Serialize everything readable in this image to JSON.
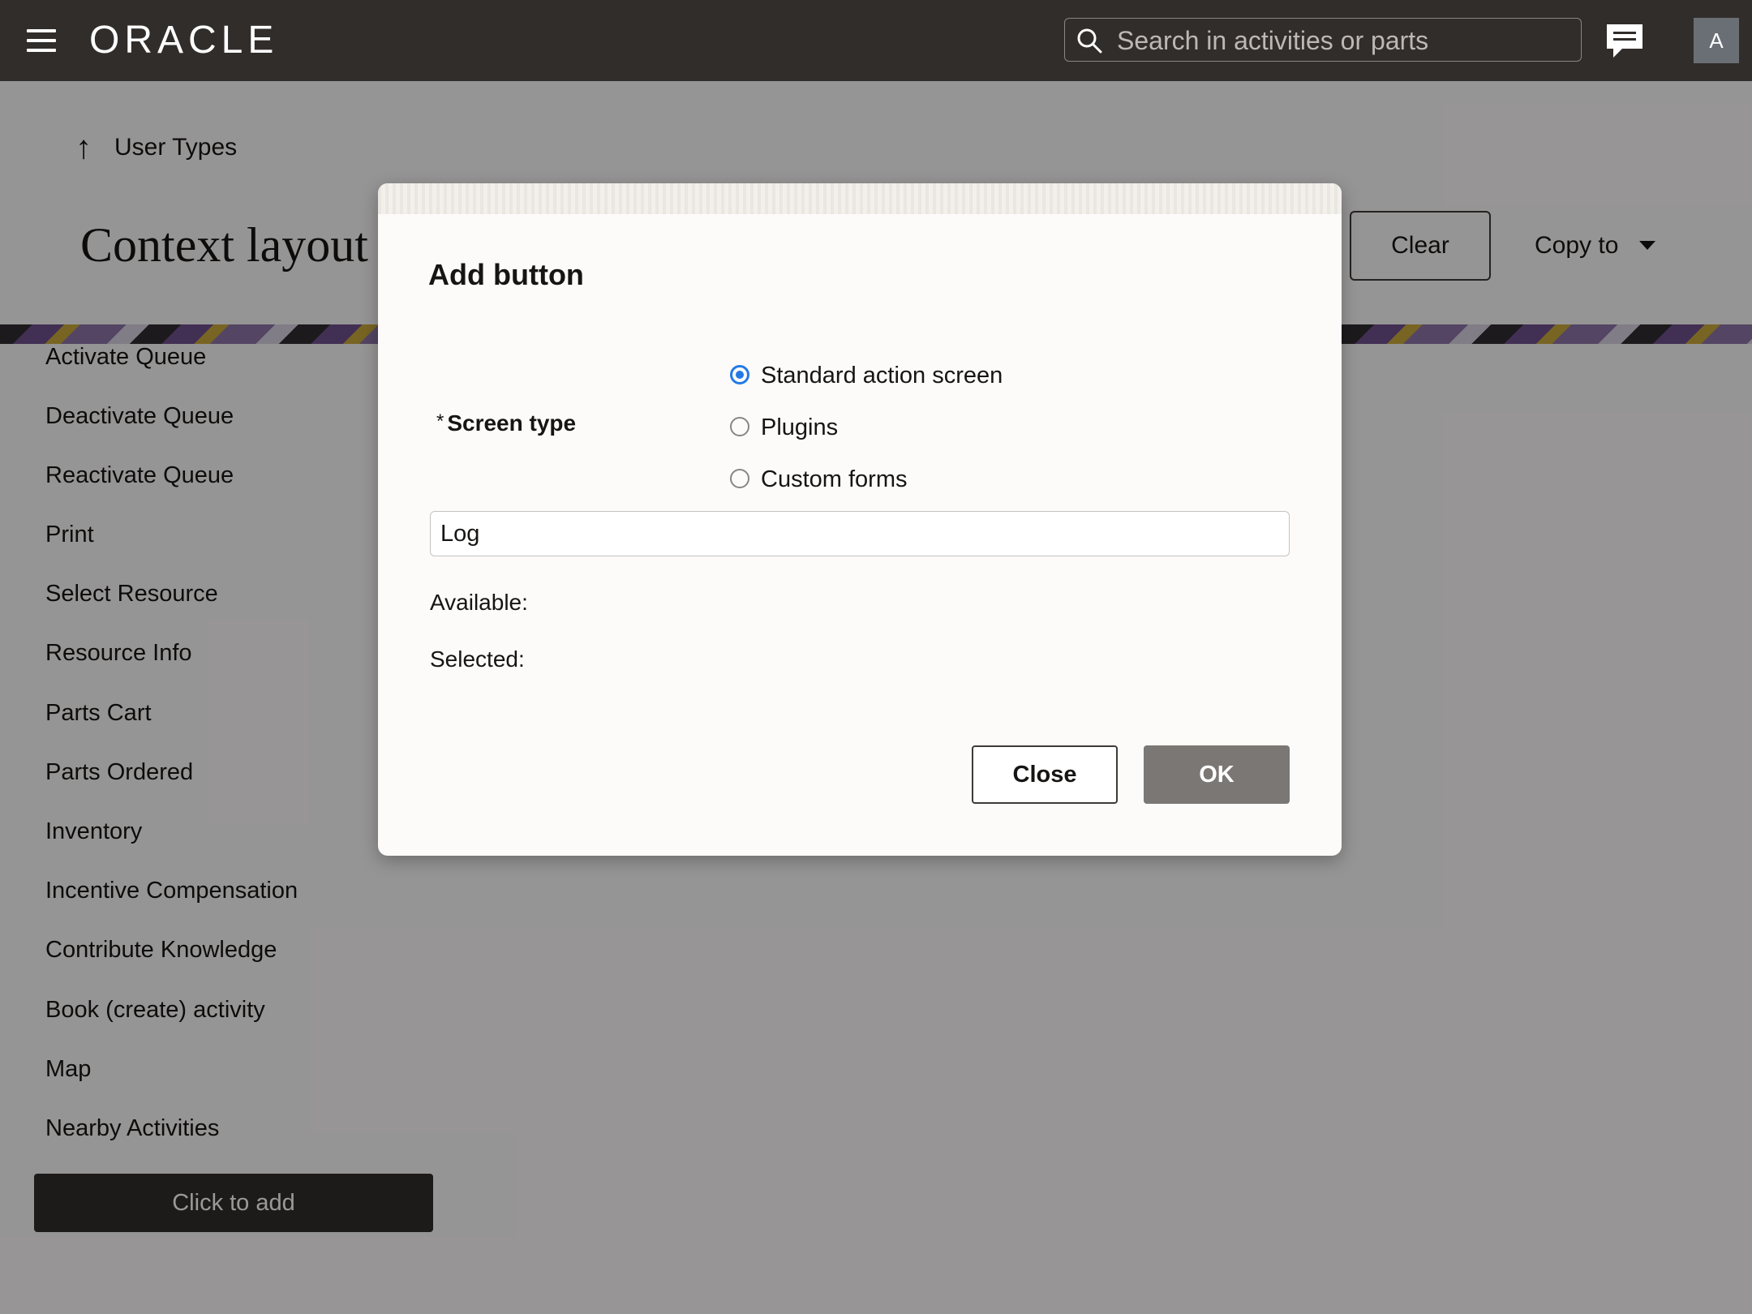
{
  "header": {
    "brand": "ORACLE",
    "search_placeholder": "Search in activities or parts",
    "avatar_initial": "A"
  },
  "page": {
    "back_label": "User Types",
    "title": "Context layout",
    "clear_label": "Clear",
    "copy_to_label": "Copy to"
  },
  "list": {
    "items": [
      "Activate Queue",
      "Deactivate Queue",
      "Reactivate Queue",
      "Print",
      "Select Resource",
      "Resource Info",
      "Parts Cart",
      "Parts Ordered",
      "Inventory",
      "Incentive Compensation",
      "Contribute Knowledge",
      "Book (create) activity",
      "Map",
      "Nearby Activities"
    ],
    "add_label": "Click to add"
  },
  "dialog": {
    "title": "Add button",
    "required_mark": "*",
    "screen_type_label": "Screen type",
    "options": [
      {
        "label": "Standard action screen",
        "selected": true
      },
      {
        "label": "Plugins",
        "selected": false
      },
      {
        "label": "Custom forms",
        "selected": false
      }
    ],
    "field_value": "Log",
    "available_label": "Available:",
    "selected_label": "Selected:",
    "close_label": "Close",
    "ok_label": "OK"
  },
  "colors": {
    "header_bg": "#312d2a",
    "radio_accent": "#227ae6",
    "ok_bg": "#7b7774"
  }
}
